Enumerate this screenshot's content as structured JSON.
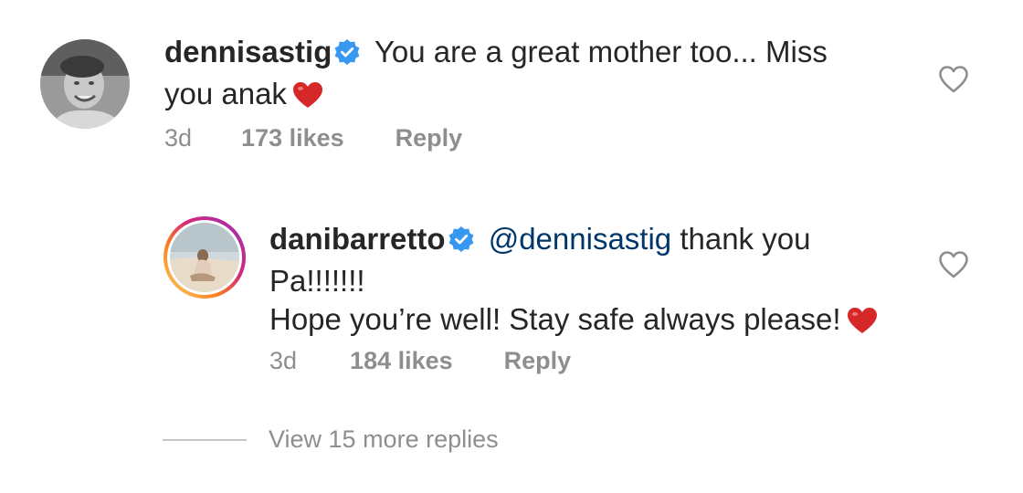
{
  "comment": {
    "username": "dennisastig",
    "text": "You are a great mother too... Miss you anak",
    "text_line1": "You are a great mother too... Miss",
    "text_line2": "you anak",
    "time": "3d",
    "likes": "173 likes",
    "reply_label": "Reply",
    "emoji": "red-heart"
  },
  "reply": {
    "username": "danibarretto",
    "mention": "@dennisastig",
    "text_line1": "thank you",
    "text_line2": "Pa!!!!!!!",
    "text_line3": "Hope you’re well! Stay safe always please!",
    "time": "3d",
    "likes": "184 likes",
    "reply_label": "Reply",
    "emoji": "red-heart"
  },
  "view_more": {
    "label": "View 15 more replies"
  },
  "colors": {
    "text": "#262626",
    "meta": "#8e8e8e",
    "mention": "#00376b",
    "verified": "#3897f0",
    "heart": "#ed4956"
  }
}
